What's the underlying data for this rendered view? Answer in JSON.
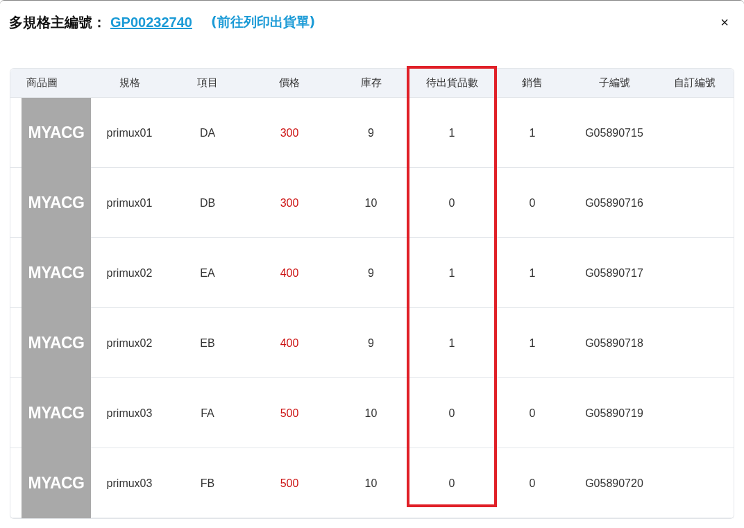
{
  "header": {
    "label": "多規格主編號：",
    "code_link": "GP00232740",
    "print_link": "(前往列印出貨單)",
    "close": "×"
  },
  "table": {
    "columns": [
      {
        "label": "商品圖",
        "highlighted": false
      },
      {
        "label": "規格",
        "highlighted": false
      },
      {
        "label": "項目",
        "highlighted": false
      },
      {
        "label": "價格",
        "highlighted": false
      },
      {
        "label": "庫存",
        "highlighted": false
      },
      {
        "label": "待出貨品數",
        "highlighted": true
      },
      {
        "label": "銷售",
        "highlighted": false
      },
      {
        "label": "子編號",
        "highlighted": false
      },
      {
        "label": "自訂編號",
        "highlighted": false
      }
    ],
    "rows": [
      {
        "image_label": "MYACG",
        "spec": "primux01",
        "item": "DA",
        "price": "300",
        "stock": "9",
        "pending": "1",
        "sales": "1",
        "sub_no": "G05890715"
      },
      {
        "image_label": "MYACG",
        "spec": "primux01",
        "item": "DB",
        "price": "300",
        "stock": "10",
        "pending": "0",
        "sales": "0",
        "sub_no": "G05890716"
      },
      {
        "image_label": "MYACG",
        "spec": "primux02",
        "item": "EA",
        "price": "400",
        "stock": "9",
        "pending": "1",
        "sales": "1",
        "sub_no": "G05890717"
      },
      {
        "image_label": "MYACG",
        "spec": "primux02",
        "item": "EB",
        "price": "400",
        "stock": "9",
        "pending": "1",
        "sales": "1",
        "sub_no": "G05890718"
      },
      {
        "image_label": "MYACG",
        "spec": "primux03",
        "item": "FA",
        "price": "500",
        "stock": "10",
        "pending": "0",
        "sales": "0",
        "sub_no": "G05890719"
      },
      {
        "image_label": "MYACG",
        "spec": "primux03",
        "item": "FB",
        "price": "500",
        "stock": "10",
        "pending": "0",
        "sales": "0",
        "sub_no": "G05890720"
      }
    ]
  }
}
